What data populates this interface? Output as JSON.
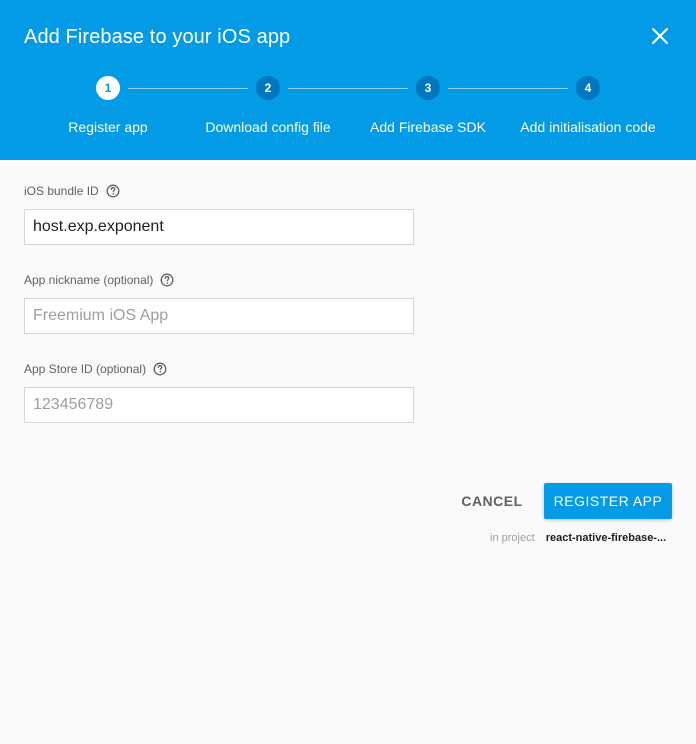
{
  "dialog": {
    "title": "Add Firebase to your iOS app",
    "colors": {
      "header": "#039be5",
      "accent": "#039be5",
      "inactive_step": "#0277bd"
    }
  },
  "stepper": {
    "steps": [
      {
        "number": "1",
        "label": "Register app",
        "active": true
      },
      {
        "number": "2",
        "label": "Download config file",
        "active": false
      },
      {
        "number": "3",
        "label": "Add Firebase SDK",
        "active": false
      },
      {
        "number": "4",
        "label": "Add initialisation code",
        "active": false
      }
    ]
  },
  "form": {
    "bundle_id": {
      "label": "iOS bundle ID",
      "value": "host.exp.exponent",
      "placeholder": ""
    },
    "nickname": {
      "label": "App nickname (optional)",
      "value": "",
      "placeholder": "Freemium iOS App"
    },
    "appstore_id": {
      "label": "App Store ID (optional)",
      "value": "",
      "placeholder": "123456789"
    }
  },
  "actions": {
    "cancel_label": "CANCEL",
    "register_label": "REGISTER APP"
  },
  "project": {
    "prefix": "in project",
    "name": "react-native-firebase-..."
  },
  "icons": {
    "close": "close-icon",
    "help": "help-circle-icon"
  }
}
